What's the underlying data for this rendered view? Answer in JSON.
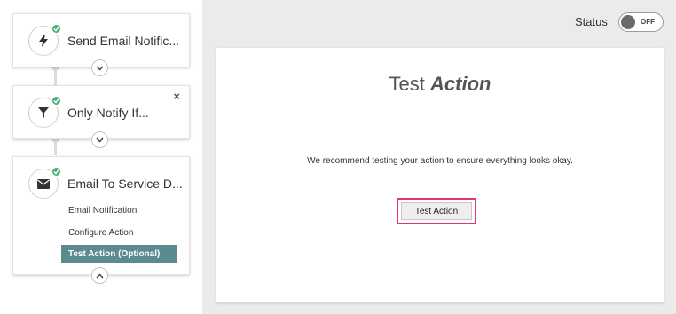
{
  "workflow": {
    "steps": [
      {
        "title": "Send Email Notific...",
        "icon": "lightning-bolt-icon"
      },
      {
        "title": "Only Notify If...",
        "icon": "funnel-filter-icon"
      },
      {
        "title": "Email To Service D...",
        "icon": "envelope-icon",
        "sub_items": [
          "Email Notification",
          "Configure Action",
          "Test Action (Optional)"
        ],
        "active_sub_item": "Test Action (Optional)"
      }
    ],
    "close_symbol": "×"
  },
  "status": {
    "label": "Status",
    "toggle_text": "OFF"
  },
  "panel": {
    "title_plain": "Test",
    "title_emphasis": "Action",
    "description": "We recommend testing your action to ensure everything looks okay.",
    "button_label": "Test Action"
  },
  "colors": {
    "check_green": "#4caf7a",
    "active_item_bg": "#5b8a8f",
    "highlight_border": "#e6336d",
    "right_bg": "#ebebeb"
  }
}
